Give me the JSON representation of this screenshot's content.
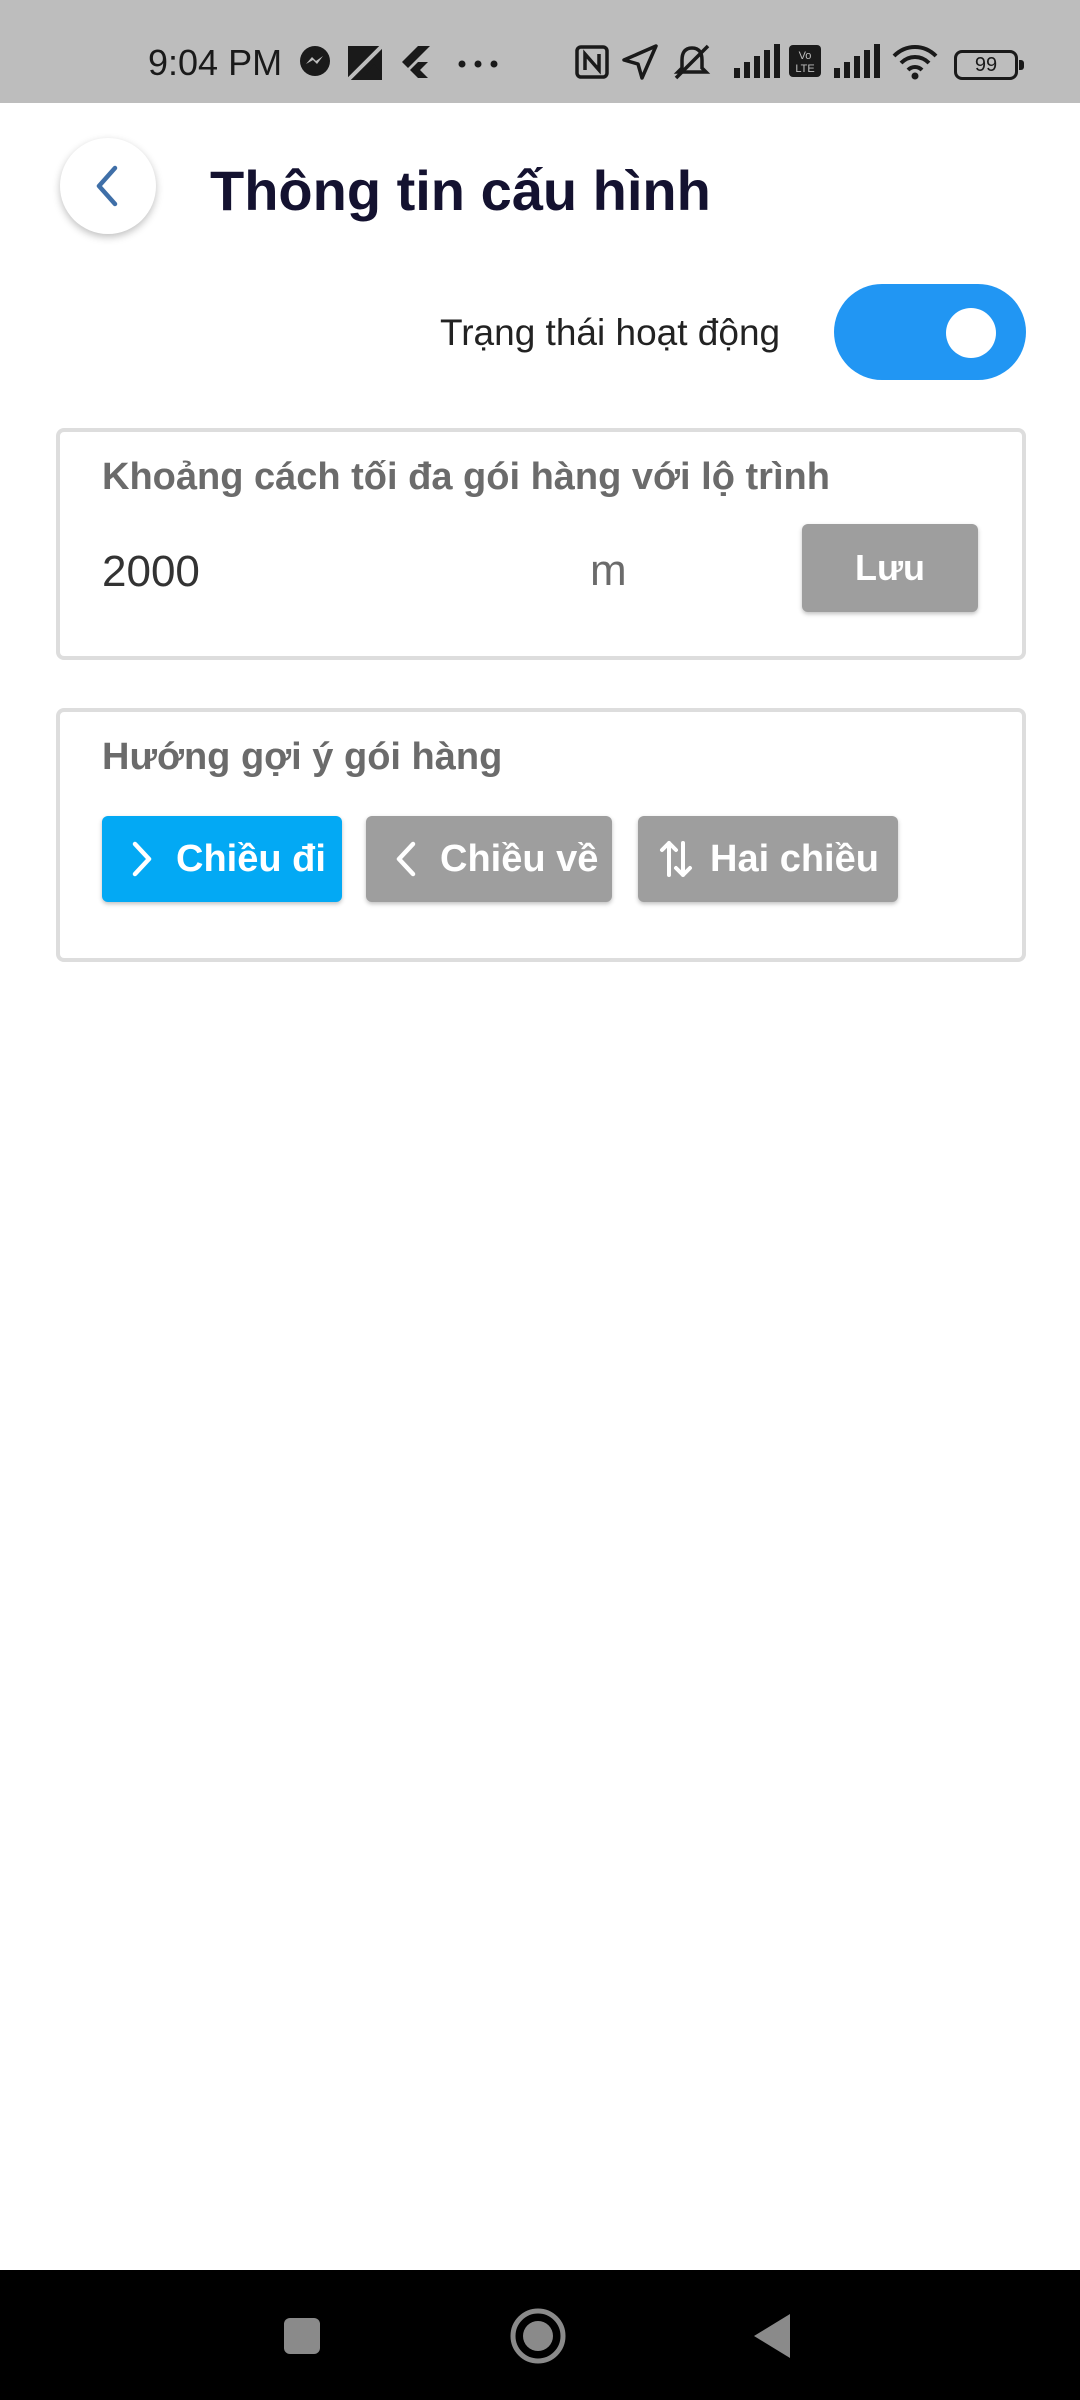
{
  "status_bar": {
    "time": "9:04 PM",
    "battery": "99",
    "icons": [
      "messenger-icon",
      "image-icon",
      "flutter-icon",
      "more-dots-icon",
      "nfc-icon",
      "location-icon",
      "mute-icon",
      "signal-icon",
      "volte-icon",
      "signal-icon-2",
      "wifi-icon",
      "battery-icon"
    ]
  },
  "header": {
    "title": "Thông tin cấu hình",
    "back_icon": "chevron-left-icon"
  },
  "active_status": {
    "label": "Trạng thái hoạt động",
    "enabled": true,
    "toggle_color": "#2196f3"
  },
  "distance": {
    "label": "Khoảng cách tối đa gói hàng với lộ trình",
    "value": "2000",
    "unit": "m",
    "save_label": "Lưu"
  },
  "direction": {
    "label": "Hướng gợi ý gói hàng",
    "options": [
      {
        "label": "Chiều đi",
        "icon": "chevron-right-icon",
        "selected": true
      },
      {
        "label": "Chiều về",
        "icon": "chevron-left-icon",
        "selected": false
      },
      {
        "label": "Hai chiều",
        "icon": "swap-vertical-icon",
        "selected": false
      }
    ],
    "selected_color": "#03a9f4",
    "unselected_color": "#9e9e9e"
  },
  "nav_bar": {
    "buttons": [
      "recents-square-icon",
      "home-circle-icon",
      "back-triangle-icon"
    ]
  }
}
